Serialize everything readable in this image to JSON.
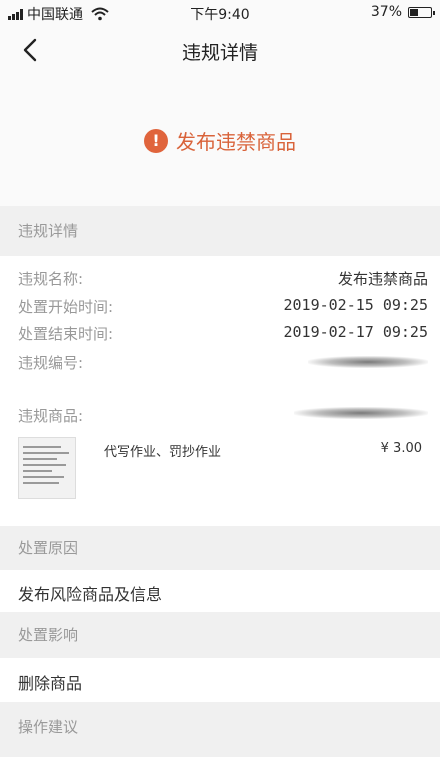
{
  "status_bar": {
    "carrier": "中国联通",
    "time": "下午9:40",
    "battery": "37%"
  },
  "nav": {
    "title": "违规详情",
    "back_icon": "chevron-left-icon"
  },
  "hero": {
    "icon": "alert-icon",
    "icon_glyph": "!",
    "text": "发布违禁商品",
    "accent": "#e0643c"
  },
  "details": {
    "section_title": "违规详情",
    "rows": [
      {
        "label": "违规名称:",
        "value": "发布违禁商品"
      },
      {
        "label": "处置开始时间:",
        "value": "2019-02-15 09:25"
      },
      {
        "label": "处置结束时间:",
        "value": "2019-02-17 09:25"
      },
      {
        "label": "违规编号:",
        "value": ""
      },
      {
        "label": "违规商品:",
        "value": ""
      }
    ],
    "product": {
      "name": "代写作业、罚抄作业",
      "price": "¥ 3.00"
    }
  },
  "reason": {
    "section_title": "处置原因",
    "text": "发布风险商品及信息"
  },
  "impact": {
    "section_title": "处置影响",
    "text": "删除商品"
  },
  "advice": {
    "section_title": "操作建议"
  }
}
